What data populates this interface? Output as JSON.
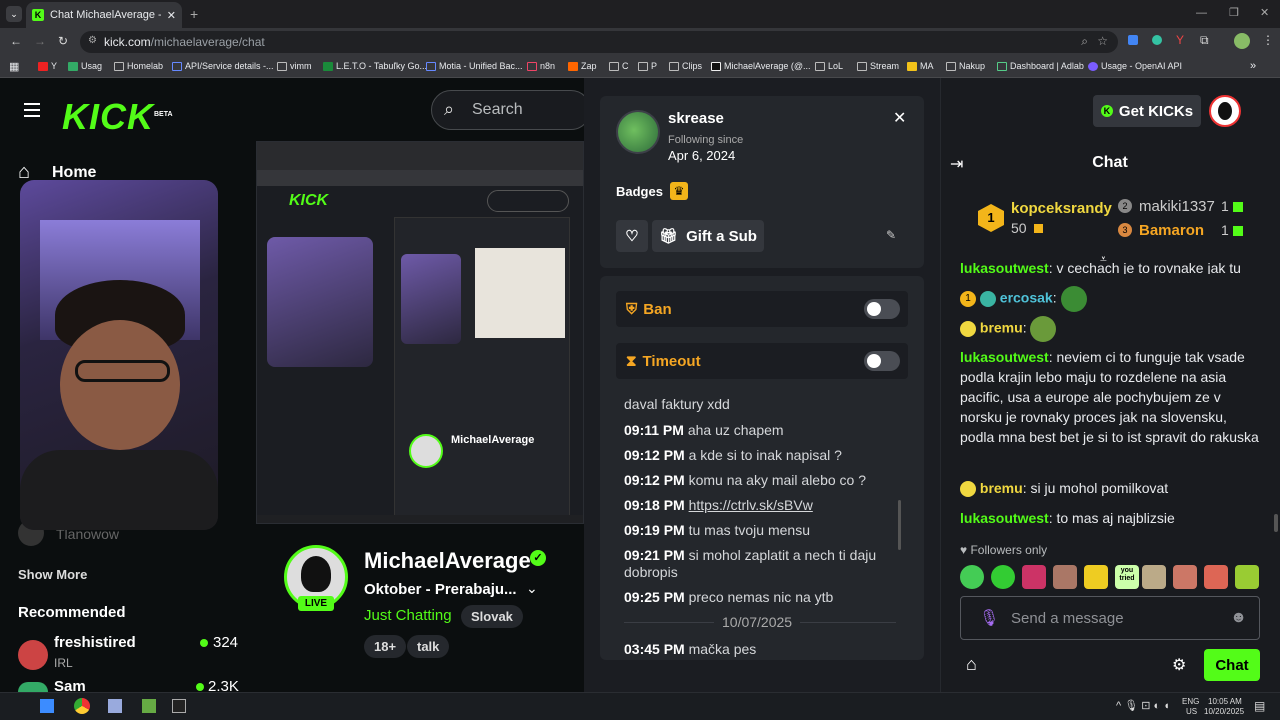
{
  "browser": {
    "tab_title": "Chat MichaelAverage - Watch l",
    "url_host": "kick.com",
    "url_path": "/michaelaverage/chat",
    "bookmarks": [
      "Y",
      "Usag",
      "Homelab",
      "API/Service details -...",
      "vimm",
      "L.E.T.O - Tabuľky Go...",
      "Motia - Unified Bac...",
      "n8n",
      "Zap",
      "C",
      "P",
      "Clips",
      "MichaelAverage (@...",
      "LoL",
      "Stream",
      "MA",
      "Nakup",
      "Dashboard | Adlab",
      "Usage - OpenAI API"
    ]
  },
  "site": {
    "logo": "KICK",
    "logo_beta": "BETA",
    "search_placeholder": "Search"
  },
  "nav": {
    "home": "Home",
    "show_more": "Show More",
    "recommended": "Recommended",
    "partial_user": "Tlanowow",
    "recs": [
      {
        "name": "freshistired",
        "category": "IRL",
        "viewers": "324"
      },
      {
        "name": "Sam",
        "viewers": "2.3K"
      }
    ]
  },
  "streamer": {
    "name": "MichaelAverage",
    "title": "Oktober  - Prerabaju...",
    "category": "Just Chatting",
    "lang": "Slovak",
    "tags": [
      "18+",
      "talk"
    ],
    "live": "LIVE"
  },
  "modal": {
    "username": "skrease",
    "following_label": "Following since",
    "following_date": "Apr 6, 2024",
    "badges_label": "Badges",
    "gift_label": "Gift a Sub",
    "ban_label": "Ban",
    "timeout_label": "Timeout",
    "messages": [
      {
        "time": "",
        "text": "daval faktury xdd"
      },
      {
        "time": "09:11 PM",
        "text": "aha uz chapem"
      },
      {
        "time": "09:12 PM",
        "text": "a kde si to inak napisal ?"
      },
      {
        "time": "09:12 PM",
        "text": "komu na aky mail alebo co ?"
      },
      {
        "time": "09:18 PM",
        "text": "https://ctrlv.sk/sBVw"
      },
      {
        "time": "09:19 PM",
        "text": "tu mas tvoju mensu"
      },
      {
        "time": "09:21 PM",
        "text": "si mohol zaplatit a nech ti daju"
      },
      {
        "time": "",
        "text": "dobropis"
      },
      {
        "time": "09:25 PM",
        "text": "preco nemas nic na ytb"
      },
      {
        "time": "",
        "text": "10/07/2025"
      },
      {
        "time": "03:45 PM",
        "text": "mačka pes"
      }
    ]
  },
  "chat": {
    "get_kicks": "Get KICKs",
    "title": "Chat",
    "leaderboard": [
      {
        "rank": "1",
        "name": "kopceksrandy",
        "count": "50"
      },
      {
        "rank": "2",
        "name": "makiki1337",
        "count": "1"
      },
      {
        "rank": "3",
        "name": "Bamaron",
        "count": "1"
      }
    ],
    "messages": [
      {
        "user": "lukasoutwest",
        "text": "v cechach je to rovnake jak tu"
      },
      {
        "user": "ercosak",
        "text": ""
      },
      {
        "user": "bremu",
        "text": ""
      },
      {
        "user": "lukasoutwest",
        "text": "neviem ci to funguje tak vsade podla krajin lebo maju to rozdelene na asia pacific, usa a europe ale pochybujem ze v norsku je rovnaky proces jak na slovensku, podla mna best bet je si to ist spravit do rakuska"
      },
      {
        "user": "bremu",
        "text": "si ju mohol pomilkovat"
      },
      {
        "user": "lukasoutwest",
        "text": "to mas aj najblizsie"
      }
    ],
    "followers_only": "Followers only",
    "emote_text": "you tried",
    "input_placeholder": "Send a message",
    "send_label": "Chat"
  },
  "taskbar": {
    "lang": "ENG",
    "region": "US",
    "time": "10:05 AM",
    "date": "10/20/2025"
  },
  "colors": {
    "accent": "#53fc18",
    "timeout": "#f5a623",
    "bg": "#0b0e0f"
  }
}
